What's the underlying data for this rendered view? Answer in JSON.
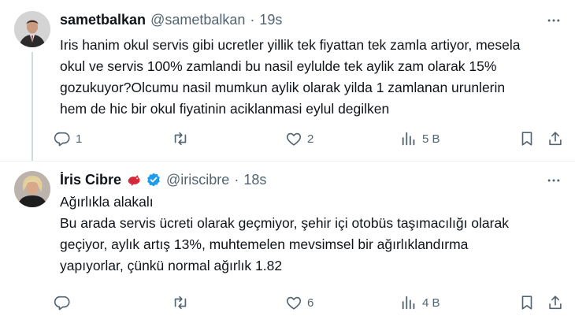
{
  "tweets": [
    {
      "display_name": "sametbalkan",
      "handle": "@sametbalkan",
      "separator": "·",
      "time": "19s",
      "lines": [
        "Iris hanim okul servis gibi ucretler yillik tek fiyattan tek zamla artiyor, mesela",
        "okul ve servis 100% zamlandi bu nasil eylulde tek aylik zam olarak 15%",
        "gozukuyor?Olcumu nasil mumkun aylik olarak yilda 1 zamlanan urunlerin",
        "hem de hic bir okul fiyatinin aciklanmasi eylul degilken"
      ],
      "reply_count": "1",
      "retweet_count": "",
      "like_count": "2",
      "views_count": "5 B"
    },
    {
      "display_name": "İris Cibre",
      "handle": "@iriscibre",
      "separator": "·",
      "time": "18s",
      "lines": [
        "Ağırlıkla alakalı",
        "Bu arada servis ücreti olarak geçmiyor, şehir içi otobüs taşımacılığı olarak",
        "geçiyor, aylık artış 13%, muhtemelen mevsimsel bir ağırlıklandırma",
        "yapıyorlar, çünkü normal ağırlık 1.82"
      ],
      "reply_count": "",
      "retweet_count": "",
      "like_count": "6",
      "views_count": "4 B"
    }
  ],
  "colors": {
    "text": "#0f1419",
    "secondary": "#536471",
    "verified": "#1d9bf0",
    "divider": "#eff3f4",
    "thread_line": "#cfd9de"
  },
  "icons": [
    "reply-icon",
    "retweet-icon",
    "heart-icon",
    "views-icon",
    "bookmark-icon",
    "share-icon",
    "more-icon",
    "verified-badge-icon",
    "bird-emoji-icon"
  ]
}
